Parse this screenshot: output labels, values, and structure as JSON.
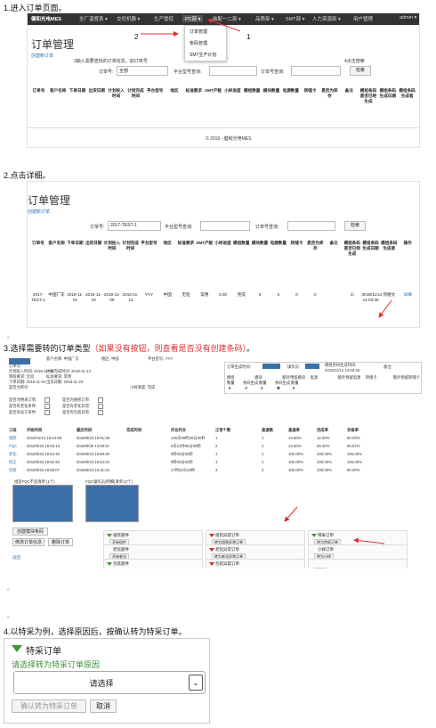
{
  "steps": {
    "s1": "1.进入订单页面。",
    "s2": "2.点击详细。",
    "s3_black": "3.选择需要转的订单类型",
    "s3_red": "（如果没有按钮，则查看是否没有创建条码）",
    "s3_end": "。",
    "s4": "4.以特采为例，选择原因后，按确认转为特采订单。",
    "small_mark": "。"
  },
  "shot1": {
    "brand": "健和光电MES",
    "nav": [
      "全厂温度表 ▾",
      "交旺机器 ▾",
      "生产管控",
      "PC部 ▾",
      "装配一二部 ▾",
      "品质部 ▾",
      "SMT部 ▾",
      "人力资源部 ▾",
      "用户管理"
    ],
    "user": "admin ▾",
    "dropdown": [
      "订单管理",
      "条码管理",
      "SMT生产计划"
    ],
    "annot": {
      "n1": "1",
      "n2": "2",
      "n3": "3输入需要查找的订单信息，如订单号",
      "n4": "4点击搜索"
    },
    "title": "订单管理",
    "create": "创建新订单",
    "filter": {
      "order_label": "订单号:",
      "order_value": "全部",
      "platform_label": "平台型号查询:",
      "order_query_label": "订单号查询:",
      "search": "检索"
    },
    "headers": [
      "订单号",
      "客户名称",
      "下单日期",
      "出货日期",
      "计划投入时间",
      "计划完成时间",
      "平台型号",
      "地区",
      "标准要求",
      "SMT产能",
      "小样进度",
      "模组数量",
      "模块数量",
      "电源数量",
      "转储卡",
      "是否为库存",
      "备注",
      "模组条码是否已经生成",
      "模组条码生成日期",
      "模组条码生成者"
    ],
    "footer": "© 2019 - 健和光电MES"
  },
  "shot2": {
    "title": "订单管理",
    "create": "创建新订单",
    "filter": {
      "order_label": "订单号:",
      "order_value": "2017-TEST-1",
      "platform_label": "平台型号查询:",
      "order_query_label": "订单号查询:",
      "search": "检索"
    },
    "headers": [
      "订单号",
      "客户名称",
      "下单日期",
      "出货日期",
      "计划投入时间",
      "计划完成时间",
      "平台型号",
      "地区",
      "标准要求",
      "SMT产能",
      "小样进度",
      "模组数量",
      "模块数量",
      "电源数量",
      "转储卡",
      "是否为库存",
      "备注",
      "模组条码是否已经生成",
      "模组条码生成日期",
      "模组条码生成者",
      "操作"
    ],
    "row": [
      "2017-TEST-1",
      "中国广东",
      "2018-11-01",
      "2018-11-23",
      "2018-11-09",
      "2018-11-13",
      "YYY",
      "中国",
      "无铅",
      "常用",
      "0.00",
      "完成",
      "6",
      "3",
      "0",
      "0",
      "",
      "☑",
      "2018/11/14 14:03:46",
      "何德文",
      "详细"
    ]
  },
  "shot3": {
    "info": [
      "订单号:",
      "客户名称: 中国广东",
      "地区: 中国",
      "平台型号: YYY",
      "计划投入时间: 2018-11-09",
      "计划完成时间: 2018-11-13",
      "制程要求: 无铅",
      "标准要求: 常用",
      "下单日期: 2018-11-01",
      "出货日期: 2018-11-23",
      "是否为库存:",
      "小样进度: 完成"
    ],
    "flags": [
      "是否为特采订单:",
      "是否有老化条件:",
      "是否有返工条件:",
      "是否为维修订单:",
      "是否有老化异常:",
      "是否有包装异常:"
    ],
    "barcode": {
      "time_label": "订单生成时间:",
      "op_label": "操作员:",
      "mod_label": "模组条码生成时间:",
      "mod_time": "2018/11/14 14:03:46",
      "note_label": "备注:"
    },
    "qty_head": [
      "模组",
      "模块",
      "额外预留模块",
      "电源",
      "额外预留电源",
      "转储卡",
      "额外预留转储卡"
    ],
    "qty_sub": [
      "数量",
      "条码生成",
      "数量",
      "条码生成",
      "数量"
    ],
    "qty_vals": [
      "6",
      "✔",
      "3",
      "✖",
      "0"
    ],
    "process_head": [
      "工段",
      "开始时间",
      "最后时间",
      "完成时间",
      "作业时长",
      "正常个数",
      "直通数",
      "直通率",
      "完成率",
      "合格率"
    ],
    "process": [
      [
        "组装",
        "2019/11/14 16:24:59",
        "2019/5/23 16:51:39",
        "",
        "126天00时26分40秒",
        "1",
        "1",
        "12.50%",
        "12.50%",
        "50.00%"
      ],
      [
        "FQC",
        "2019/5/23 16:53:13",
        "2019/5/30 13:59:21",
        "",
        "6天21时06分08秒",
        "2",
        "1",
        "12.50%",
        "25.00%",
        "66.67%"
      ],
      [
        "老化",
        "2019/5/23 16:54:40",
        "2019/5/23 16:59:40",
        "",
        "0时00分05秒",
        "1",
        "1",
        "100.00%",
        "100.00%",
        "100.00%"
      ],
      [
        "校正",
        "2019/5/23 16:52:20",
        "2019/5/23 16:52:22",
        "",
        "0时00分02秒",
        "1",
        "1",
        "100.00%",
        "100.00%",
        "100.00%"
      ],
      [
        "包装",
        "2019/5/23 16:59:07",
        "2019/5/24 10:31:22",
        "",
        "17时32分15秒",
        "4",
        "4",
        "100.00%",
        "100.00%",
        "80.00%"
      ]
    ],
    "chart_titles": [
      "组装FQC不良清单:(1个)",
      "FQC操作员(明细)清单:(2个)"
    ],
    "buttons": [
      "创建模块条码",
      "修改订单信息",
      "删除订单"
    ],
    "back": "返回",
    "cards": [
      {
        "title": "组装部件",
        "btn": "开始组件",
        "color": "g"
      },
      {
        "title": "组装异常订单",
        "btn": "转为组装异常订单",
        "color": "r"
      },
      {
        "title": "特采订单",
        "btn": "转为特采订单",
        "color": "g"
      },
      {
        "title": "老化部件",
        "btn": "开始老化",
        "color": "b"
      },
      {
        "title": "老化异常订单",
        "btn": "转为老化异常订单",
        "color": "r"
      },
      {
        "title": "小样订单",
        "btn": "转为小样",
        "color": "b"
      },
      {
        "title": "包装部件",
        "btn": "",
        "color": "g"
      },
      {
        "title": "包装异常订单",
        "btn": "",
        "color": "r"
      },
      {
        "title": "",
        "btn": "上传",
        "color": "b"
      }
    ]
  },
  "shot4": {
    "header": "特采订单",
    "prompt": "请选择转为特采订单原因",
    "select_placeholder": "请选择",
    "confirm": "确认转为特采订单",
    "cancel": "取消"
  },
  "colors": {
    "nav_bg": "#333333",
    "red": "#e03030",
    "link": "#2a6ebb",
    "green_text": "#3a8f3a"
  }
}
